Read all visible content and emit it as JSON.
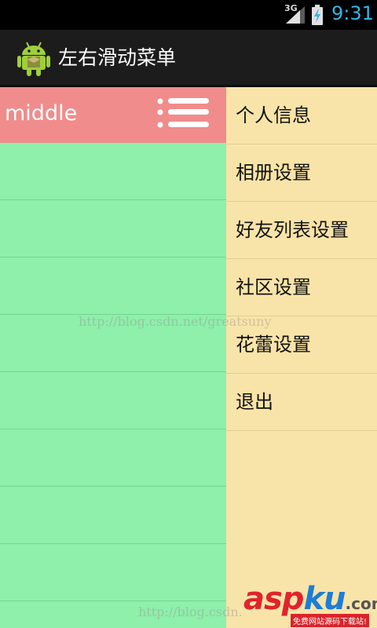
{
  "status_bar": {
    "network_type": "3G",
    "time": "9:31",
    "clock_color": "#34b5e5",
    "icons": [
      "signal-icon",
      "battery-charging-icon"
    ]
  },
  "title_bar": {
    "app_title": "左右滑动菜单",
    "icon": "android-robot-icon"
  },
  "middle": {
    "title": "middle",
    "menu_icon": "list-menu-icon",
    "header_color": "#f08c8c",
    "body_color": "#8ef0aa"
  },
  "right_menu": {
    "background": "#f8e4a8",
    "items": [
      {
        "label": "个人信息"
      },
      {
        "label": "相册设置"
      },
      {
        "label": "好友列表设置"
      },
      {
        "label": "社区设置"
      },
      {
        "label": "花蕾设置"
      },
      {
        "label": "退出"
      }
    ]
  },
  "watermarks": {
    "url_text_1": "http://blog.csdn.net/greatsuny",
    "url_text_2": "http://blog.csdn.",
    "logo_part1": "asp",
    "logo_part2": "ku",
    "logo_suffix": ".com",
    "slogan": "免费网站源码下载站!"
  }
}
